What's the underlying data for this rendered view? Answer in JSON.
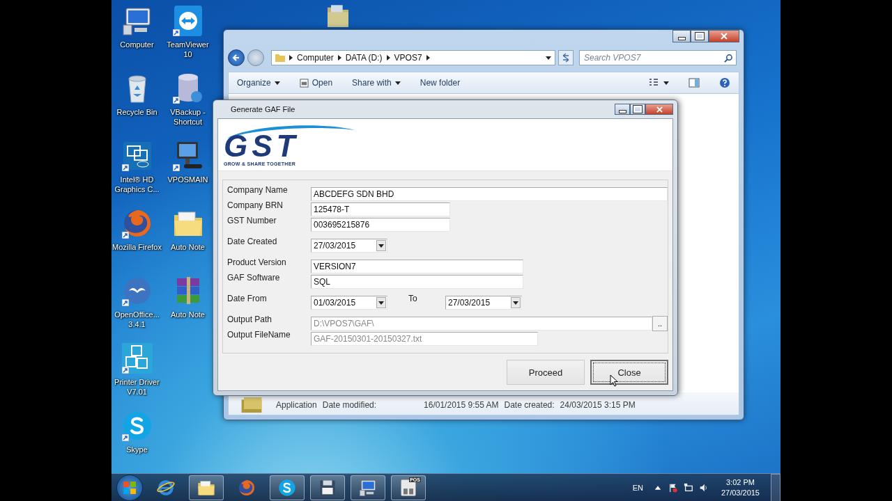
{
  "desktop_icons": [
    {
      "kind": "computer",
      "label": "Computer",
      "shortcut": false
    },
    {
      "kind": "recycle",
      "label": "Recycle Bin",
      "shortcut": false
    },
    {
      "kind": "intel",
      "label": "Intel® HD Graphics C...",
      "shortcut": true
    },
    {
      "kind": "firefox",
      "label": "Mozilla Firefox",
      "shortcut": true
    },
    {
      "kind": "openoffice",
      "label": "OpenOffice... 3.4.1",
      "shortcut": true
    },
    {
      "kind": "blocks",
      "label": "Printer Driver V7.01",
      "shortcut": true
    },
    {
      "kind": "skype",
      "label": "Skype",
      "shortcut": true
    },
    {
      "kind": "teamviewer",
      "label": "TeamViewer 10",
      "shortcut": true
    },
    {
      "kind": "database",
      "label": "VBackup - Shortcut",
      "shortcut": true
    },
    {
      "kind": "terminal",
      "label": "VPOSMAIN",
      "shortcut": true
    },
    {
      "kind": "folder",
      "label": "Auto Note",
      "shortcut": false
    },
    {
      "kind": "archive",
      "label": "Auto Note",
      "shortcut": false
    }
  ],
  "explorer": {
    "breadcrumb": [
      "Computer",
      "DATA (D:)",
      "VPOS7"
    ],
    "search": {
      "placeholder": "Search VPOS7"
    },
    "toolbar": [
      {
        "label": "Organize",
        "kind": "menu"
      },
      {
        "label": "Open",
        "kind": "open"
      },
      {
        "label": "Share with",
        "kind": "menu"
      },
      {
        "label": "New folder",
        "kind": "plain"
      }
    ],
    "details": [
      "Application",
      "Date modified:",
      "16/01/2015 9:55 AM",
      "Date created:",
      "24/03/2015 3:15 PM"
    ]
  },
  "dialog": {
    "title": "Generate GAF File",
    "logo": {
      "text": "GST",
      "tagline": "GROW & SHARE TOGETHER"
    },
    "fields": [
      {
        "label": "Company Name",
        "value": "ABCDEFG SDN BHD",
        "kind": "text",
        "disabled": false
      },
      {
        "label": "Company BRN",
        "value": "125478-T",
        "kind": "text",
        "disabled": false
      },
      {
        "label": "GST Number",
        "value": "003695215876",
        "kind": "text",
        "disabled": false
      },
      {
        "label": "Date Created",
        "value": "27/03/2015",
        "kind": "combo",
        "disabled": false
      },
      {
        "label": "Product Version",
        "value": "VERSION7",
        "kind": "text",
        "disabled": false
      },
      {
        "label": "GAF Software",
        "value": "SQL",
        "kind": "text",
        "disabled": false
      },
      {
        "label": "Date From",
        "value": "01/03/2015",
        "kind": "range",
        "to_label": "To",
        "to_value": "27/03/2015",
        "disabled": false
      },
      {
        "label": "Output Path",
        "value": "D:\\VPOS7\\GAF\\",
        "kind": "browse",
        "browse_label": "..",
        "disabled": true
      },
      {
        "label": "Output FileName",
        "value": "GAF-20150301-20150327.txt",
        "kind": "text",
        "disabled": true
      }
    ],
    "buttons": [
      {
        "label": "Proceed",
        "selected": false
      },
      {
        "label": "Close",
        "selected": true
      }
    ]
  },
  "taskbar": {
    "apps": [
      {
        "kind": "ie",
        "running": false
      },
      {
        "kind": "folder",
        "running": true
      },
      {
        "kind": "firefox",
        "running": false
      },
      {
        "kind": "skype",
        "running": true
      },
      {
        "kind": "floppy",
        "running": true
      },
      {
        "kind": "computer",
        "running": true
      },
      {
        "kind": "pos",
        "running": true,
        "label": "POS"
      }
    ],
    "language": "EN",
    "time": "3:02 PM",
    "date": "27/03/2015"
  }
}
